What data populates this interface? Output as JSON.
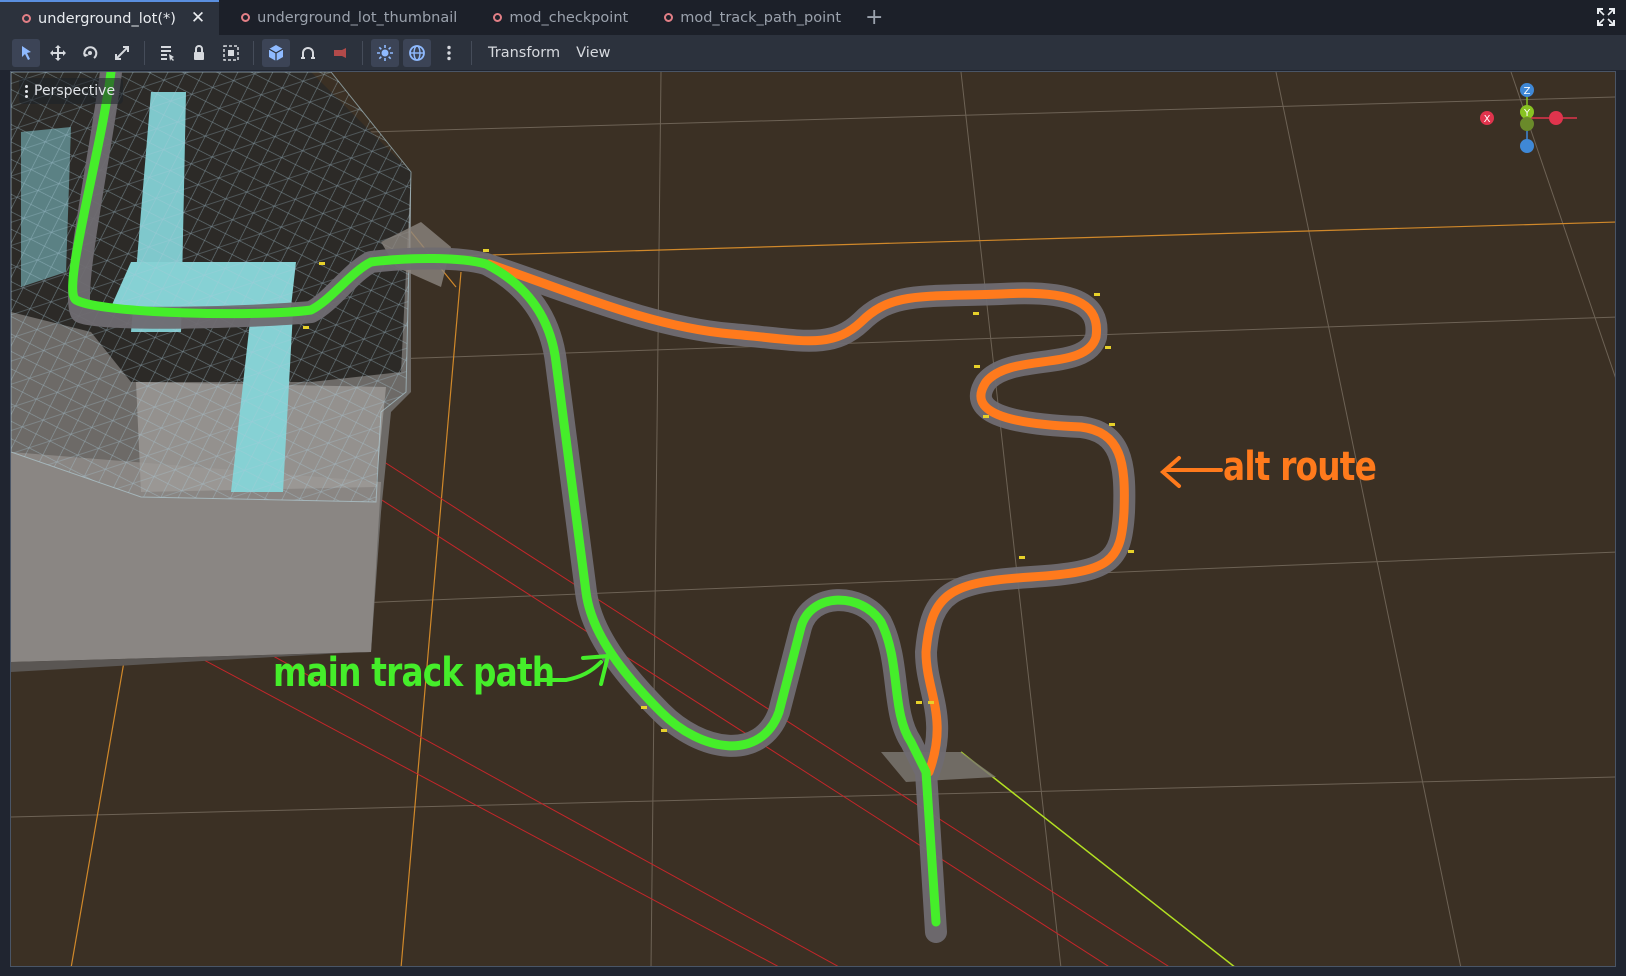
{
  "tabs": [
    {
      "label": "underground_lot(*)",
      "active": true
    },
    {
      "label": "underground_lot_thumbnail",
      "active": false
    },
    {
      "label": "mod_checkpoint",
      "active": false
    },
    {
      "label": "mod_track_path_point",
      "active": false
    }
  ],
  "add_tab_symbol": "+",
  "close_symbol": "✕",
  "toolbar": {
    "tools": [
      "select-icon",
      "move-icon",
      "rotate-icon",
      "scale-icon",
      "list-select-icon",
      "lock-icon",
      "group-icon",
      "local-space-icon",
      "snap-icon",
      "camera-icon",
      "sun-icon",
      "environment-icon",
      "more-icon"
    ],
    "menus": [
      "Transform",
      "View"
    ]
  },
  "viewport": {
    "view_mode": "Perspective",
    "annotations": {
      "main_track": "main track path",
      "alt_route": "alt route"
    },
    "gizmo_axes": {
      "z": "Z",
      "y": "Y",
      "x": "X"
    }
  },
  "colors": {
    "main_path": "#45ee2a",
    "alt_path": "#ff7a1c",
    "ground": "#3b3024",
    "accent": "#5a8fe0",
    "axis_x": "#e0344d",
    "axis_y": "#88c322",
    "axis_z": "#3f88d6"
  }
}
